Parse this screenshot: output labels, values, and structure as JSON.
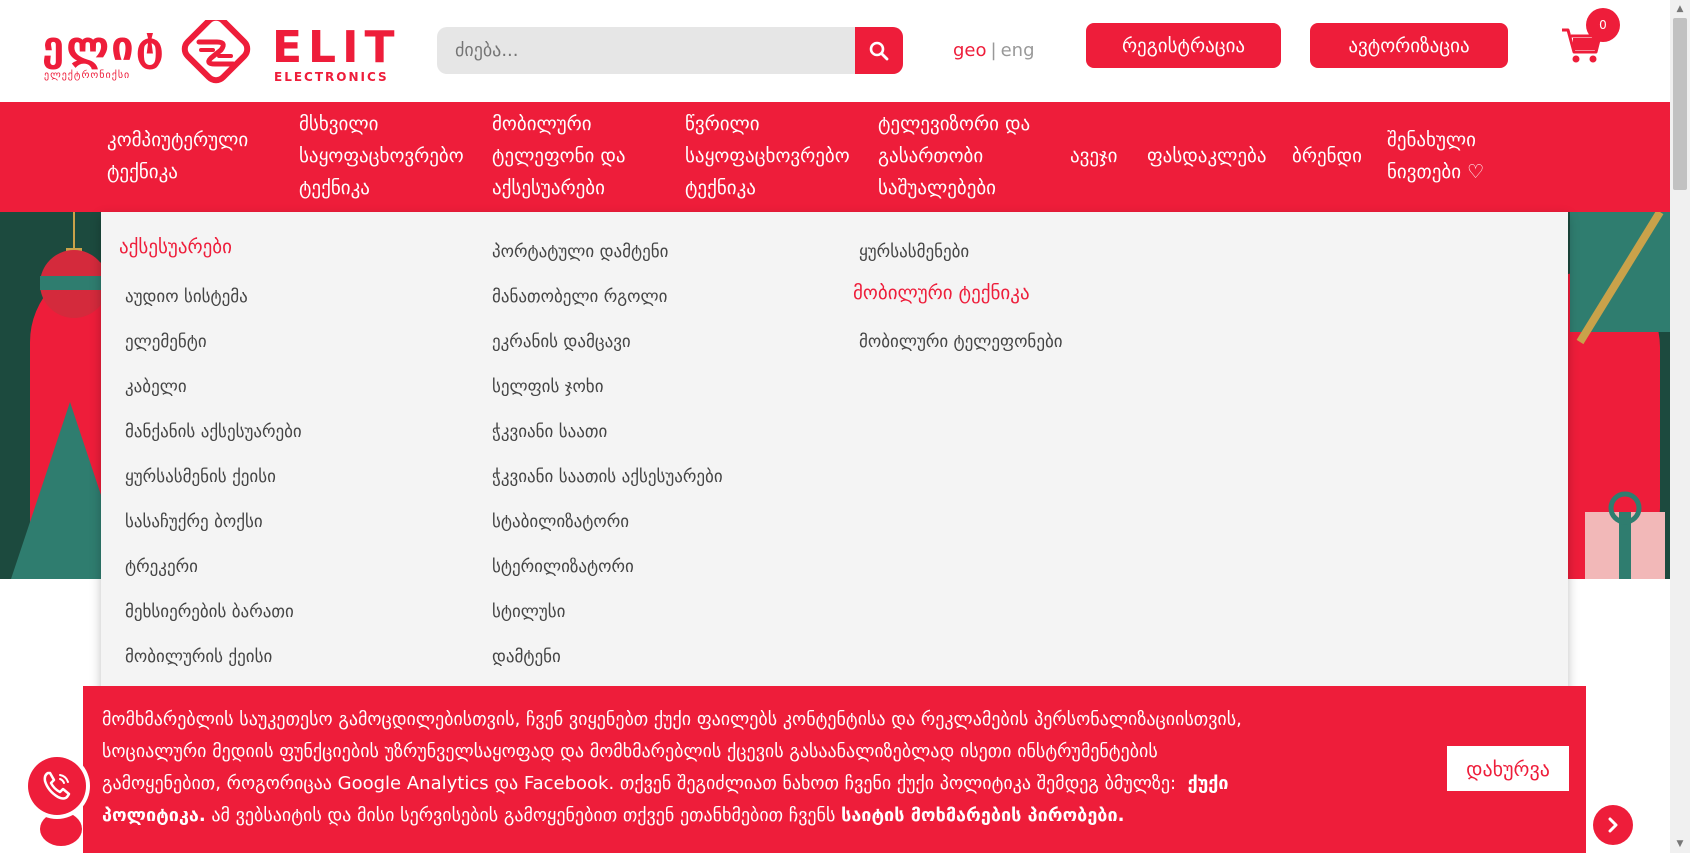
{
  "brand": {
    "georgian": "ელიტ",
    "georgian_sub": "ელექტრონიქსი",
    "name": "ELIT",
    "sub": "ELECTRONICS",
    "color": "#ee1d3a"
  },
  "search": {
    "placeholder": "ძიება...",
    "icon": "search-icon"
  },
  "lang": {
    "geo": "geo",
    "sep": "|",
    "eng": "eng"
  },
  "header_buttons": {
    "register": "რეგისტრაცია",
    "login": "ავტორიზაცია"
  },
  "cart": {
    "count": "0",
    "icon": "cart-icon"
  },
  "nav": [
    {
      "l1": "კომპიუტერული",
      "l2": "ტექნიკა",
      "l3": ""
    },
    {
      "l1": "მსხვილი",
      "l2": "საყოფაცხოვრებო",
      "l3": "ტექნიკა"
    },
    {
      "l1": "მობილური",
      "l2": "ტელეფონი და",
      "l3": "აქსესუარები"
    },
    {
      "l1": "წვრილი",
      "l2": "საყოფაცხოვრებო",
      "l3": "ტექნიკა"
    },
    {
      "l1": "ტელევიზორი და",
      "l2": "გასართობი",
      "l3": "საშუალებები"
    },
    {
      "l1": "ავეჯი",
      "l2": "",
      "l3": ""
    },
    {
      "l1": "ფასდაკლება",
      "l2": "",
      "l3": ""
    },
    {
      "l1": "ბრენდი",
      "l2": "",
      "l3": ""
    },
    {
      "l1": "შენახული",
      "l2": "ნივთები ♡",
      "l3": ""
    }
  ],
  "mega": {
    "col1_header": "აქსესუარები",
    "col1": [
      "აუდიო სისტემა",
      "ელემენტი",
      "კაბელი",
      "მანქანის აქსესუარები",
      "ყურსასმენის ქეისი",
      "სასაჩუქრე ბოქსი",
      "ტრეკერი",
      "მეხსიერების ბარათი",
      "მობილურის ქეისი"
    ],
    "col2": [
      "პორტატული დამტენი",
      "მანათობელი რგოლი",
      "ეკრანის დამცავი",
      "სელფის ჯოხი",
      "ჭკვიანი საათი",
      "ჭკვიანი საათის აქსესუარები",
      "სტაბილიზატორი",
      "სტერილიზატორი",
      "სტილუსი",
      "დამტენი"
    ],
    "col3_top": "ყურსასმენები",
    "col3_header": "მობილური ტექნიკა",
    "col3": [
      "მობილური ტელეფონები"
    ]
  },
  "cookie": {
    "line1": "მომხმარებლის საუკეთესო გამოცდილებისთვის, ჩვენ ვიყენებთ ქუქი ფაილებს კონტენტისა და რეკლამების პერსონალიზაციისთვის,",
    "line2": "სოციალური მედიის ფუნქციების უზრუნველსაყოფად და მომხმარებლის ქცევის გასაანალიზებლად ისეთი ინსტრუმენტების",
    "line3": "გამოყენებით, როგორიცაა Google Analytics და Facebook. თქვენ შეგიძლიათ ნახოთ ჩვენი ქუქი პოლიტიკა შემდეგ ბმულზე:",
    "policy_link_a": "ქუქი",
    "policy_link_b": "პოლიტიკა.",
    "line4": "ამ ვებსაიტის და მისი სერვისების გამოყენებით თქვენ ეთანხმებით ჩვენს",
    "terms_link": "საიტის მოხმარების პირობები.",
    "close": "დახურვა"
  },
  "floating": {
    "phone_icon": "phone-icon",
    "arrow_icon": "chevron-right-icon"
  }
}
